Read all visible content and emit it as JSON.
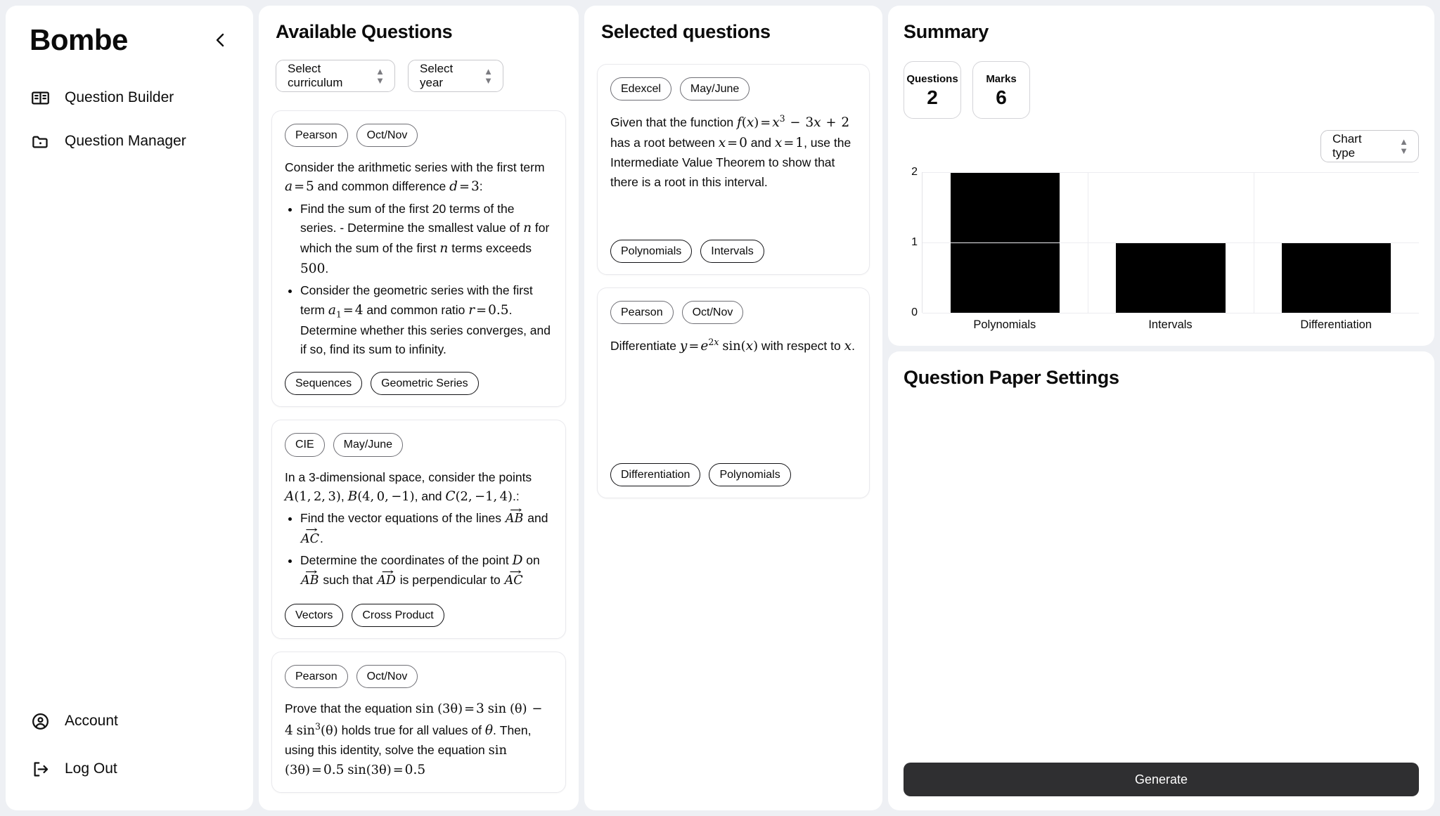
{
  "sidebar": {
    "brand": "Bombe",
    "collapse_icon": "chevron-left-icon",
    "items": [
      {
        "label": "Question Builder",
        "icon": "book-open-icon"
      },
      {
        "label": "Question Manager",
        "icon": "folder-icon"
      }
    ],
    "footer_items": [
      {
        "label": "Account",
        "icon": "user-circle-icon"
      },
      {
        "label": "Log Out",
        "icon": "logout-icon"
      }
    ]
  },
  "available": {
    "title": "Available Questions",
    "curriculum_select": "Select curriculum",
    "year_select": "Select year",
    "questions": [
      {
        "board": "Pearson",
        "session": "Oct/Nov",
        "intro": "Consider the arithmetic series with the first term a = 5 and common difference d = 3:",
        "bullets": [
          "Find the sum of the first 20 terms of the series. - Determine the smallest value of n for which the sum of the first n terms exceeds 500.",
          "Consider the geometric series with the first term a₁ = 4 and common ratio r = 0.5. Determine whether this series converges, and if so, find its sum to infinity."
        ],
        "tags": [
          "Sequences",
          "Geometric Series"
        ]
      },
      {
        "board": "CIE",
        "session": "May/June",
        "intro": "In a 3-dimensional space, consider the points A(1, 2, 3), B(4, 0, −1), and C(2, −1, 4).:",
        "bullets": [
          "Find the vector equations of the lines AB and AC.",
          "Determine the coordinates of the point D on AB such that AD is perpendicular to AC"
        ],
        "tags": [
          "Vectors",
          "Cross Product"
        ]
      },
      {
        "board": "Pearson",
        "session": "Oct/Nov",
        "intro": "Prove that the equation sin (3θ) = 3 sin (θ) − 4 sin³(θ) holds true for all values of θ. Then, using this identity, solve the equation sin (3θ) = 0.5 sin(3θ) = 0.5",
        "bullets": [],
        "tags": []
      }
    ]
  },
  "selected": {
    "title": "Selected questions",
    "questions": [
      {
        "board": "Edexcel",
        "session": "May/June",
        "text": "Given that the function f(x) = x³ − 3x + 2 has a root between x = 0 and x = 1, use the Intermediate Value Theorem to show that there is a root in this interval.",
        "tags": [
          "Polynomials",
          "Intervals"
        ]
      },
      {
        "board": "Pearson",
        "session": "Oct/Nov",
        "text": "Differentiate y = e²ˣ sin(x) with respect to x.",
        "tags": [
          "Differentiation",
          "Polynomials"
        ]
      }
    ]
  },
  "summary": {
    "title": "Summary",
    "stats": [
      {
        "label": "Questions",
        "value": "2"
      },
      {
        "label": "Marks",
        "value": "6"
      }
    ],
    "chart_type_select": "Chart type"
  },
  "chart_data": {
    "type": "bar",
    "categories": [
      "Polynomials",
      "Intervals",
      "Differentiation"
    ],
    "values": [
      2,
      1,
      1
    ],
    "title": "",
    "xlabel": "",
    "ylabel": "",
    "ylim": [
      0,
      2
    ],
    "yticks": [
      0,
      1,
      2
    ],
    "grid": true,
    "legend": "none",
    "bar_color": "#000000"
  },
  "settings": {
    "title": "Question Paper Settings",
    "generate_label": "Generate"
  }
}
